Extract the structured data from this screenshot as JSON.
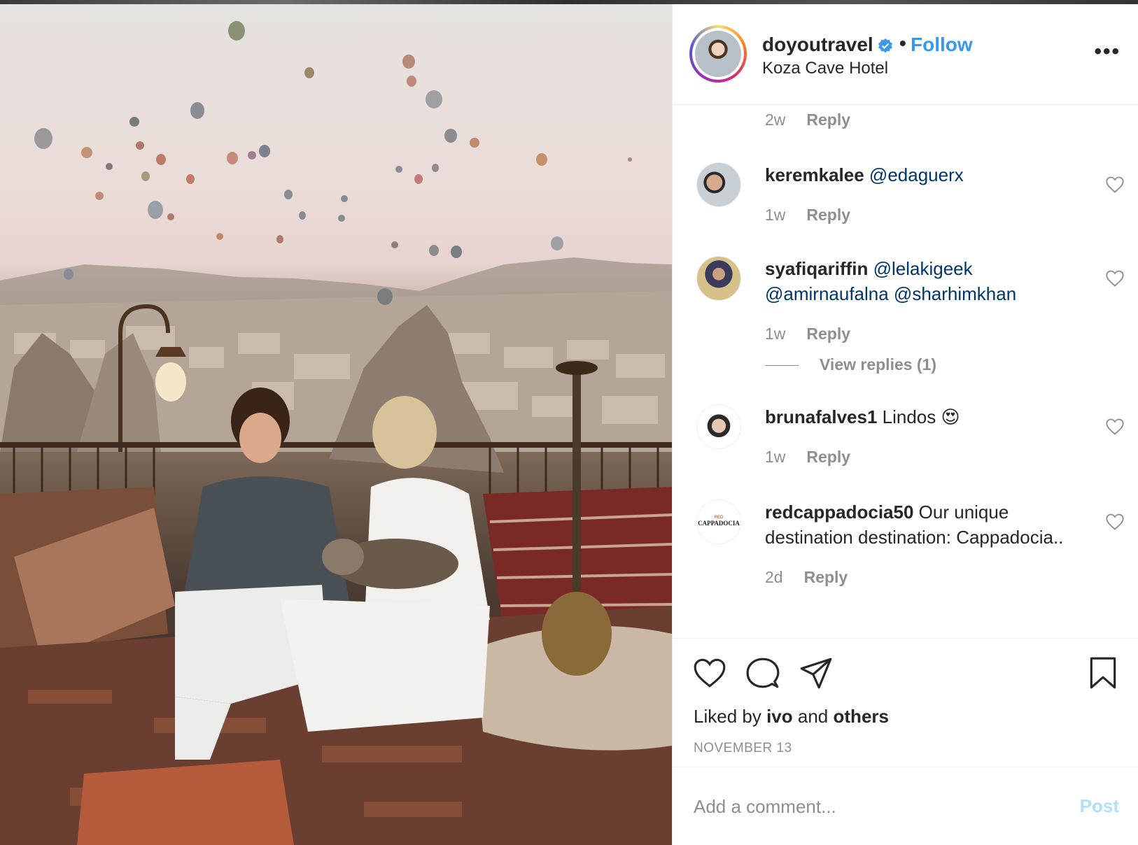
{
  "post": {
    "image_description_icon": "photo",
    "header": {
      "username": "doyoutravel",
      "verified_icon": "verified-badge-icon",
      "separator": "•",
      "follow_label": "Follow",
      "location": "Koza Cave Hotel",
      "more_icon": "more-options-icon",
      "more_label": "•••"
    },
    "comments": {
      "top_meta": {
        "time": "2w",
        "reply": "Reply"
      },
      "items": [
        {
          "username": "keremkalee",
          "text": "@edaguerx",
          "time": "1w",
          "reply": "Reply"
        },
        {
          "username": "syafiqariffin",
          "text_line1": "@lelakigeek",
          "text_line2": "@amirnaufalna @sharhimkhan",
          "time": "1w",
          "reply": "Reply",
          "view_replies": "View replies (1)"
        },
        {
          "username": "brunafalves1",
          "text": "Lindos",
          "emoji": "😍",
          "time": "1w",
          "reply": "Reply"
        },
        {
          "username": "redcappadocia50",
          "text": "Our unique destination destination: Cappadocia..",
          "time": "2d",
          "reply": "Reply",
          "avatar_text_small": "RED",
          "avatar_text": "CAPPADOCIA"
        }
      ]
    },
    "actions": {
      "like_icon": "heart-icon",
      "comment_icon": "comment-icon",
      "share_icon": "share-icon",
      "save_icon": "bookmark-icon",
      "liked_by_prefix": "Liked by",
      "liked_by_user": "ivo",
      "liked_by_and": "and",
      "liked_by_others": "others",
      "date": "NOVEMBER 13"
    },
    "add_comment": {
      "placeholder": "Add a comment...",
      "post_label": "Post"
    }
  },
  "colors": {
    "accent": "#3897f0",
    "mention": "#003569",
    "muted": "#8e8e8e",
    "post_disabled": "#b2dffc"
  }
}
